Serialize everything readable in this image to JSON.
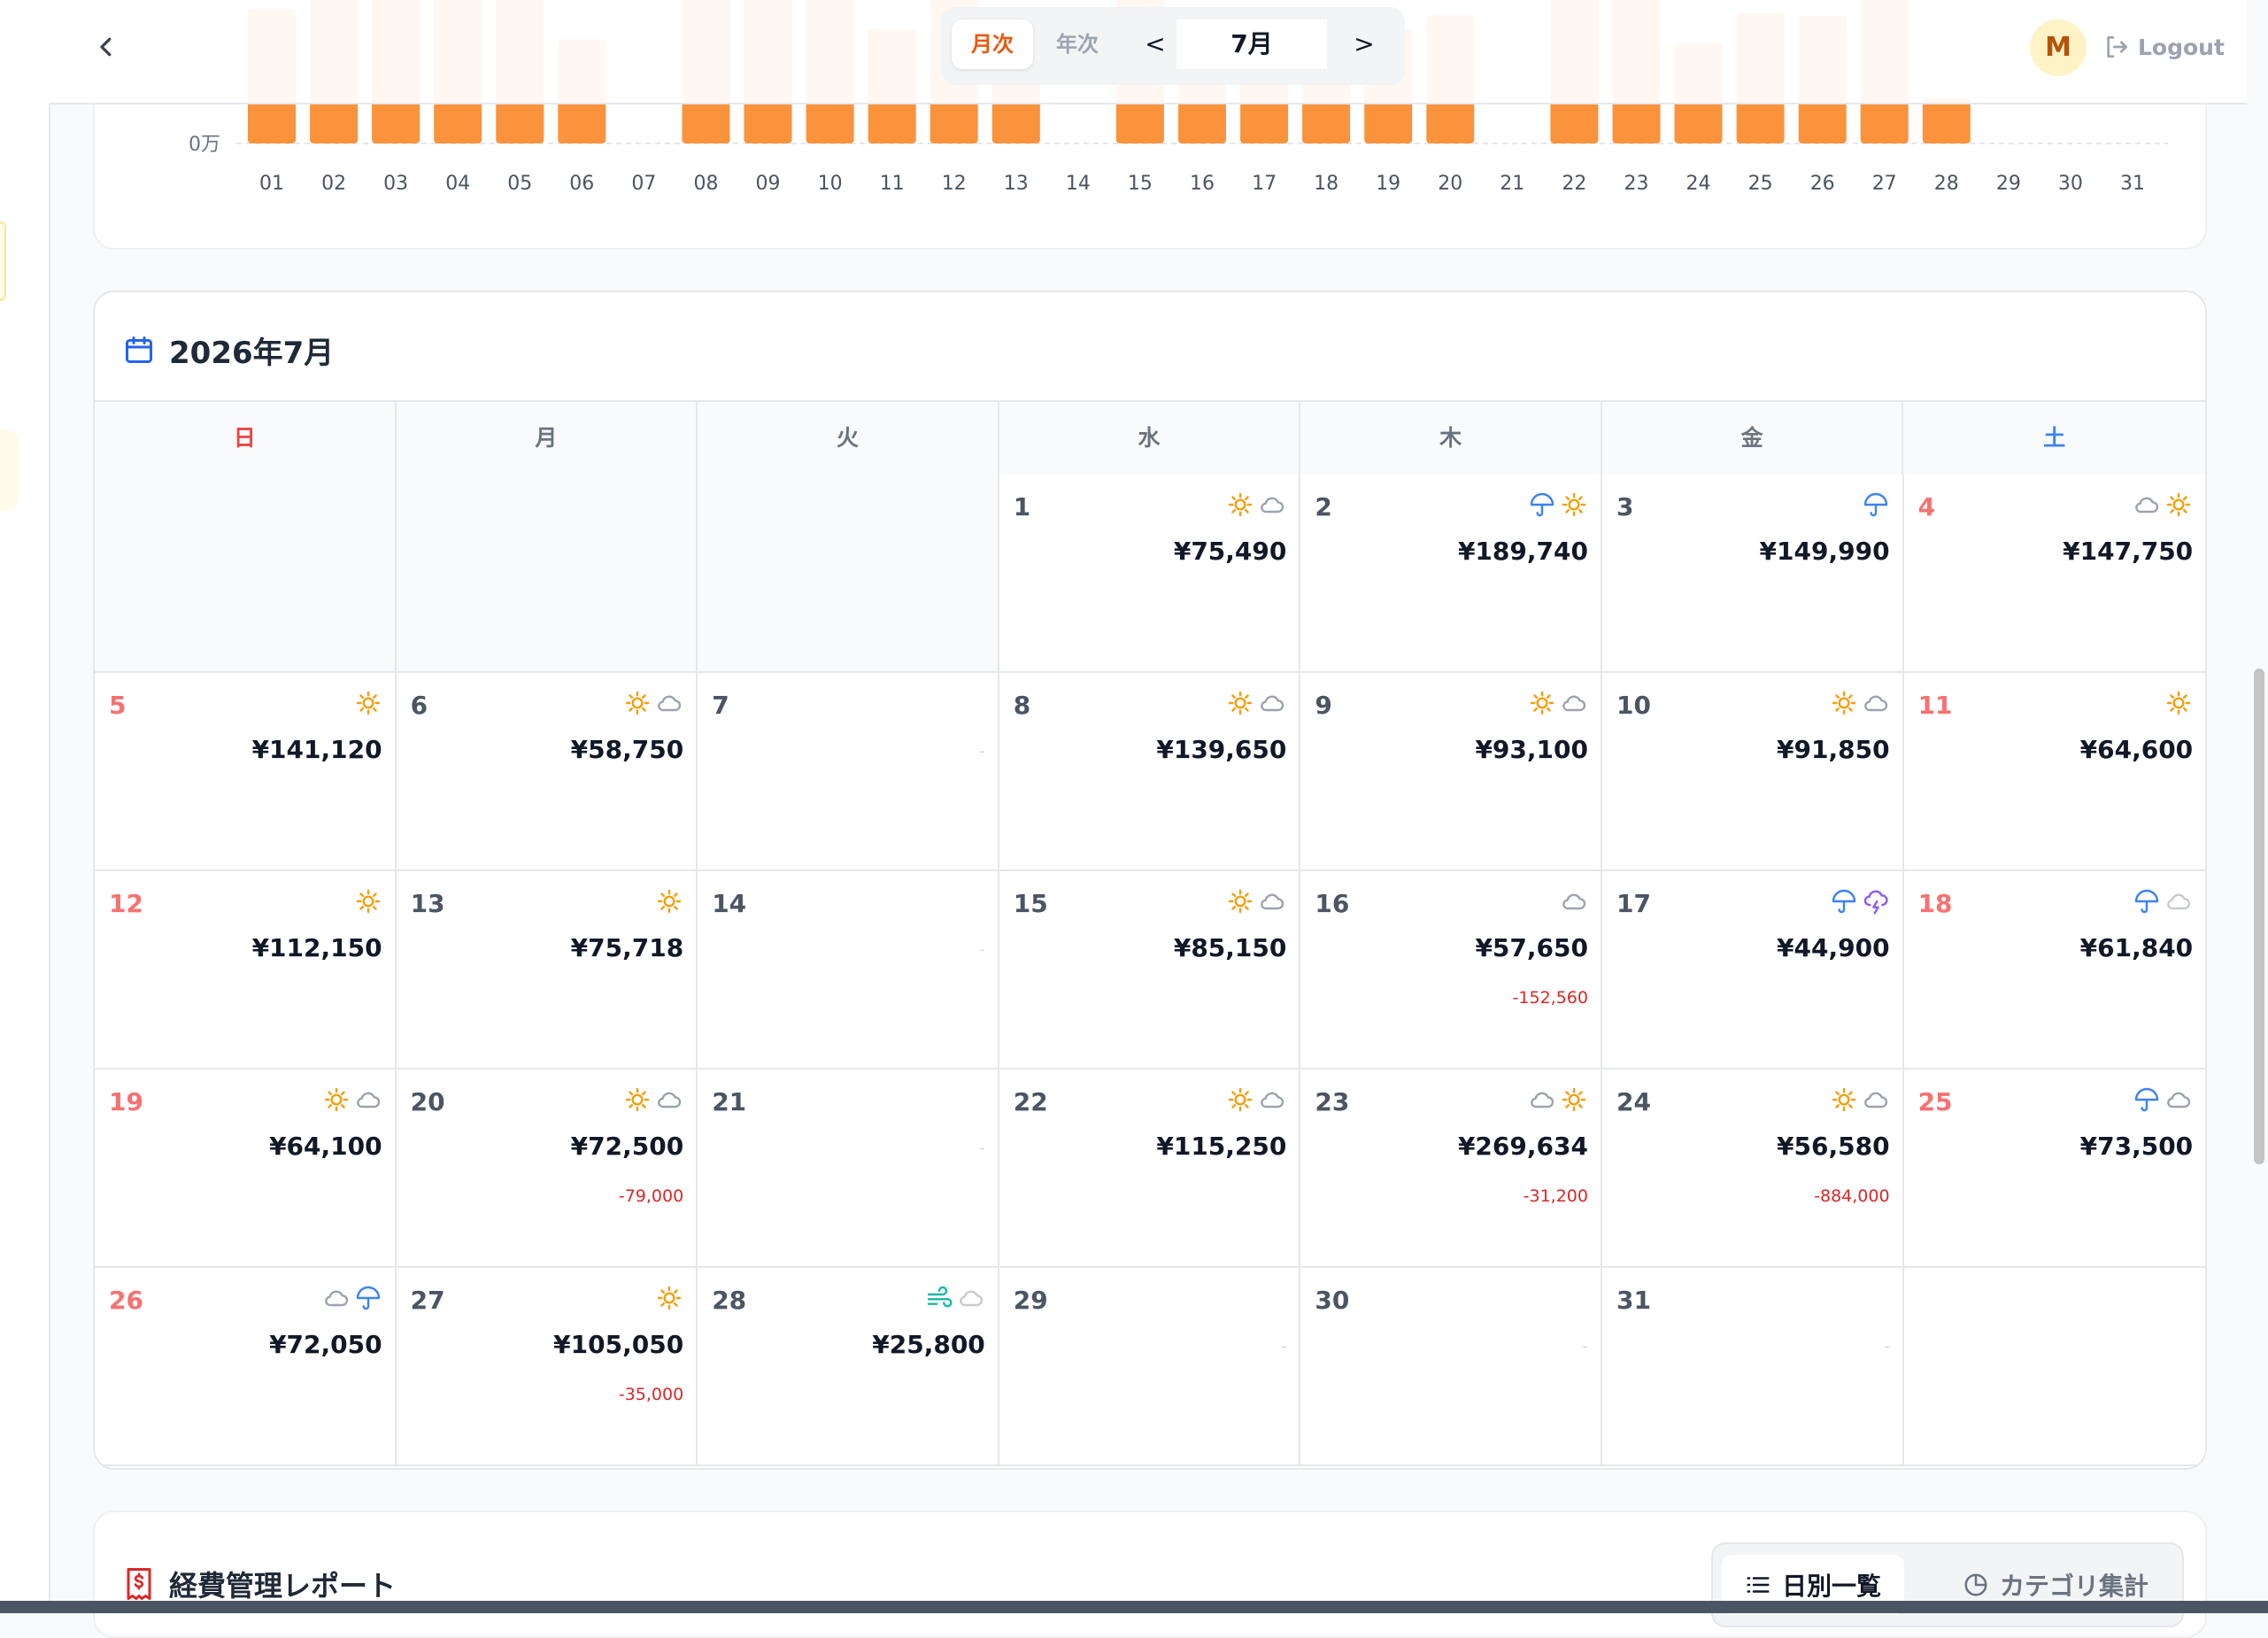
{
  "colors": {
    "accent": "#fb923c",
    "sunday": "#f87171",
    "saturday_header": "#3b82f6",
    "negative": "#dc2626",
    "sun_icon": "#f59e0b",
    "cloud_icon": "#9ca3af",
    "rain_icon": "#3b82f6",
    "thunder_icon": "#8b5cf6",
    "wind_icon": "#14b8a6"
  },
  "header": {
    "back_icon": "chevron-left-icon",
    "view_toggle": {
      "monthly": "月次",
      "yearly": "年次",
      "active": "monthly"
    },
    "prev": "<",
    "next": ">",
    "current_month": "7月",
    "avatar_initial": "M",
    "logout_label": "Logout",
    "logout_icon": "logout-icon"
  },
  "chart_data": {
    "type": "bar",
    "y_tick_labels": [
      "0万"
    ],
    "categories": [
      "01",
      "02",
      "03",
      "04",
      "05",
      "06",
      "07",
      "08",
      "09",
      "10",
      "11",
      "12",
      "13",
      "14",
      "15",
      "16",
      "17",
      "18",
      "19",
      "20",
      "21",
      "22",
      "23",
      "24",
      "25",
      "26",
      "27",
      "28",
      "29",
      "30",
      "31"
    ],
    "values": [
      75490,
      189740,
      149990,
      147750,
      141120,
      58750,
      0,
      139650,
      93100,
      91850,
      64600,
      112150,
      75718,
      0,
      85150,
      57650,
      44900,
      61840,
      64100,
      72500,
      0,
      115250,
      269634,
      56580,
      73500,
      72050,
      105050,
      25800,
      0,
      0,
      0
    ],
    "grid": "dashed baseline",
    "color": "#fb923c"
  },
  "calendar": {
    "title": "2026年7月",
    "title_icon": "calendar-icon",
    "weekdays": [
      "日",
      "月",
      "火",
      "水",
      "木",
      "金",
      "土"
    ],
    "lead_blanks": 3,
    "days": [
      {
        "day": "1",
        "amount": "¥75,490",
        "weather": [
          "sun",
          "cloud"
        ]
      },
      {
        "day": "2",
        "amount": "¥189,740",
        "weather": [
          "rain",
          "sun"
        ]
      },
      {
        "day": "3",
        "amount": "¥149,990",
        "weather": [
          "rain"
        ]
      },
      {
        "day": "4",
        "amount": "¥147,750",
        "weather": [
          "cloud",
          "sun"
        ]
      },
      {
        "day": "5",
        "amount": "¥141,120",
        "weather": [
          "sun"
        ]
      },
      {
        "day": "6",
        "amount": "¥58,750",
        "weather": [
          "sun",
          "cloud"
        ]
      },
      {
        "day": "7",
        "empty_mark": "-",
        "weather": []
      },
      {
        "day": "8",
        "amount": "¥139,650",
        "weather": [
          "sun",
          "cloud"
        ]
      },
      {
        "day": "9",
        "amount": "¥93,100",
        "weather": [
          "sun",
          "cloud"
        ]
      },
      {
        "day": "10",
        "amount": "¥91,850",
        "weather": [
          "sun",
          "cloud"
        ]
      },
      {
        "day": "11",
        "amount": "¥64,600",
        "weather": [
          "sun"
        ]
      },
      {
        "day": "12",
        "amount": "¥112,150",
        "weather": [
          "sun"
        ]
      },
      {
        "day": "13",
        "amount": "¥75,718",
        "weather": [
          "sun"
        ]
      },
      {
        "day": "14",
        "empty_mark": "-",
        "weather": []
      },
      {
        "day": "15",
        "amount": "¥85,150",
        "weather": [
          "sun",
          "cloud"
        ]
      },
      {
        "day": "16",
        "amount": "¥57,650",
        "sub": "-152,560",
        "weather": [
          "cloud"
        ]
      },
      {
        "day": "17",
        "amount": "¥44,900",
        "weather": [
          "rain",
          "thunder"
        ]
      },
      {
        "day": "18",
        "amount": "¥61,840",
        "weather": [
          "rain",
          "cloud-light"
        ]
      },
      {
        "day": "19",
        "amount": "¥64,100",
        "weather": [
          "sun",
          "cloud"
        ]
      },
      {
        "day": "20",
        "amount": "¥72,500",
        "sub": "-79,000",
        "weather": [
          "sun",
          "cloud"
        ]
      },
      {
        "day": "21",
        "empty_mark": "-",
        "weather": []
      },
      {
        "day": "22",
        "amount": "¥115,250",
        "weather": [
          "sun",
          "cloud"
        ]
      },
      {
        "day": "23",
        "amount": "¥269,634",
        "sub": "-31,200",
        "weather": [
          "cloud",
          "sun"
        ]
      },
      {
        "day": "24",
        "amount": "¥56,580",
        "sub": "-884,000",
        "weather": [
          "sun",
          "cloud"
        ]
      },
      {
        "day": "25",
        "amount": "¥73,500",
        "weather": [
          "rain",
          "cloud"
        ]
      },
      {
        "day": "26",
        "amount": "¥72,050",
        "weather": [
          "cloud",
          "rain"
        ]
      },
      {
        "day": "27",
        "amount": "¥105,050",
        "sub": "-35,000",
        "weather": [
          "sun"
        ]
      },
      {
        "day": "28",
        "amount": "¥25,800",
        "weather": [
          "wind",
          "cloud-light"
        ]
      },
      {
        "day": "29",
        "empty_mark": "-",
        "weather": []
      },
      {
        "day": "30",
        "empty_mark": "-",
        "weather": []
      },
      {
        "day": "31",
        "empty_mark": "-",
        "weather": []
      }
    ],
    "trail_blanks": 1
  },
  "report": {
    "title": "経費管理レポート",
    "title_icon": "dollar-receipt-icon",
    "tabs": [
      {
        "label": "日別一覧",
        "icon": "list-icon",
        "active": true
      },
      {
        "label": "カテゴリ集計",
        "icon": "pie-chart-icon",
        "active": false
      }
    ]
  }
}
